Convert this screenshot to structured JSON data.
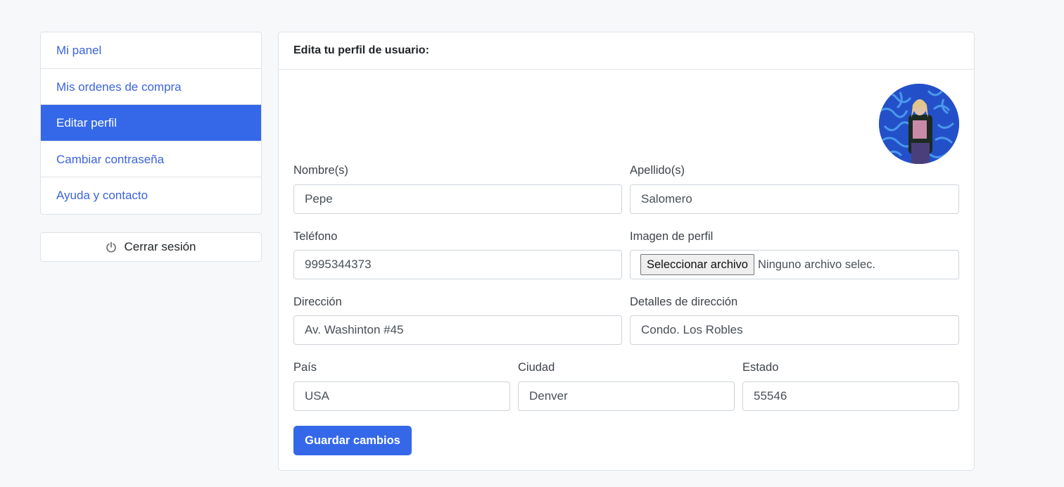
{
  "sidebar": {
    "items": [
      {
        "label": "Mi panel",
        "active": false
      },
      {
        "label": "Mis ordenes de compra",
        "active": false
      },
      {
        "label": "Editar perfil",
        "active": true
      },
      {
        "label": "Cambiar contraseña",
        "active": false
      },
      {
        "label": "Ayuda y contacto",
        "active": false
      }
    ],
    "logout": {
      "label": "Cerrar sesión",
      "icon": "power-icon"
    }
  },
  "form": {
    "title": "Edita tu perfil de usuario:",
    "nombre": {
      "label": "Nombre(s)",
      "value": "Pepe"
    },
    "apellido": {
      "label": "Apellido(s)",
      "value": "Salomero"
    },
    "telefono": {
      "label": "Teléfono",
      "value": "9995344373"
    },
    "imagen": {
      "label": "Imagen de perfil",
      "button": "Seleccionar archivo",
      "status": "Ninguno archivo selec."
    },
    "direccion": {
      "label": "Dirección",
      "value": "Av. Washinton #45"
    },
    "detalles": {
      "label": "Detalles de dirección",
      "value": "Condo. Los Robles"
    },
    "pais": {
      "label": "País",
      "value": "USA"
    },
    "ciudad": {
      "label": "Ciudad",
      "value": "Denver"
    },
    "estado": {
      "label": "Estado",
      "value": "55546"
    },
    "save_label": "Guardar cambios"
  },
  "colors": {
    "accent": "#3468e8",
    "link": "#3d63dd"
  }
}
